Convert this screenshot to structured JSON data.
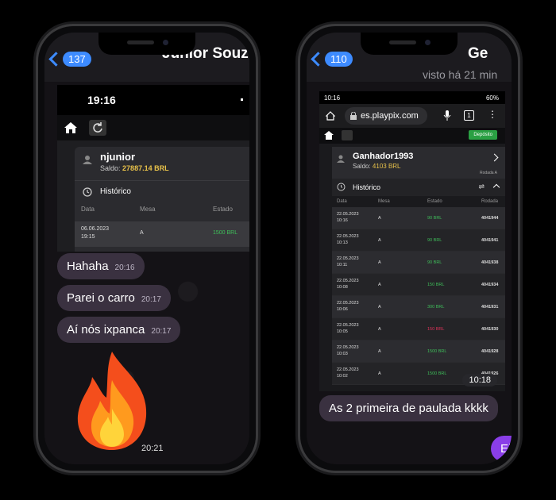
{
  "left": {
    "header": {
      "back_count": "137",
      "contact_name": "Junior Souza"
    },
    "screenshot": {
      "clock": "19:16",
      "user": "njunior",
      "saldo_label": "Saldo:",
      "saldo": "27887.14 BRL",
      "history_label": "Histórico",
      "cols": [
        "Data",
        "Mesa",
        "Estado"
      ],
      "row": {
        "date": "06.06.2023",
        "time": "19:15",
        "mesa": "A",
        "estado": "1500 BRL"
      }
    },
    "messages": [
      {
        "text": "Hahaha",
        "time": "20:16"
      },
      {
        "text": "Parei o carro",
        "time": "20:17"
      },
      {
        "text": "Aí nós ixpanca",
        "time": "20:17"
      }
    ],
    "fire_time": "20:21"
  },
  "right": {
    "header": {
      "back_count": "110",
      "contact_name": "Ge",
      "status": "visto há 21 min"
    },
    "screenshot": {
      "status_time": "10:16",
      "battery": "60%",
      "url": "es.playpix.com",
      "tabs_count": "1",
      "deposit": "Depósito",
      "user": "Ganhador1993",
      "saldo_label": "Saldo:",
      "saldo": "4103 BRL",
      "rodada": "Rodada A",
      "history_label": "Histórico",
      "cols": [
        "Data",
        "Mesa",
        "Estado",
        "Rodada"
      ],
      "rows": [
        {
          "date": "22.05.2023",
          "time": "10:16",
          "mesa": "A",
          "estado": "90 BRL",
          "rodada": "4041944"
        },
        {
          "date": "22.05.2023",
          "time": "10:13",
          "mesa": "A",
          "estado": "90 BRL",
          "rodada": "4041941"
        },
        {
          "date": "22.05.2023",
          "time": "10:11",
          "mesa": "A",
          "estado": "90 BRL",
          "rodada": "4041938"
        },
        {
          "date": "22.05.2023",
          "time": "10:08",
          "mesa": "A",
          "estado": "150 BRL",
          "rodada": "4041934"
        },
        {
          "date": "22.05.2023",
          "time": "10:06",
          "mesa": "A",
          "estado": "300 BRL",
          "rodada": "4041931"
        },
        {
          "date": "22.05.2023",
          "time": "10:05",
          "mesa": "A",
          "estado": "150 BRL",
          "rodada": "4041930"
        },
        {
          "date": "22.05.2023",
          "time": "10:03",
          "mesa": "A",
          "estado": "1500 BRL",
          "rodada": "4041928"
        },
        {
          "date": "22.05.2023",
          "time": "10:02",
          "mesa": "A",
          "estado": "1500 BRL",
          "rodada": "4041926"
        }
      ],
      "shot_time": "10:18"
    },
    "message": "As 2 primeira de paulada kkkk",
    "sent_bubble": "Eita"
  },
  "colors": {
    "accent": "#3d8bff",
    "won": "#3fbf5a",
    "lost": "#e0335a",
    "bubble": "#3a3140",
    "sent": "#8a3ee8"
  }
}
